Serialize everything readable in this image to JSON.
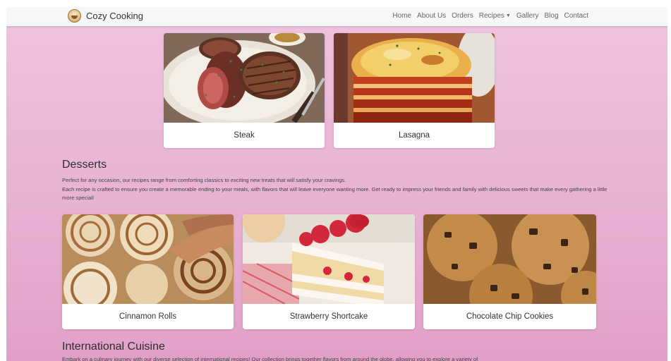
{
  "navbar": {
    "brand": "Cozy Cooking",
    "links": [
      "Home",
      "About Us",
      "Orders",
      "Recipes",
      "Gallery",
      "Blog",
      "Contact"
    ]
  },
  "main_dishes": {
    "cards": [
      {
        "title": "Steak"
      },
      {
        "title": "Lasagna"
      }
    ]
  },
  "desserts": {
    "heading": "Desserts",
    "line1": "Perfect for any occasion, our recipes range from comforting classics to exciting new treats that will satisfy your cravings.",
    "line2": "Each recipe is crafted to ensure you create a memorable ending to your meals, with flavors that will leave everyone wanting more. Get ready to impress your friends and family with delicious sweets that make every gathering a little more special!",
    "cards": [
      {
        "title": "Cinnamon Rolls"
      },
      {
        "title": "Strawberry Shortcake"
      },
      {
        "title": "Chocolate Chip Cookies"
      }
    ]
  },
  "international": {
    "heading": "International Cuisine",
    "line1": "Embark on a culinary journey with our diverse selection of international recipes! Our collection brings together flavors from around the globe, allowing you to explore a variety of"
  }
}
